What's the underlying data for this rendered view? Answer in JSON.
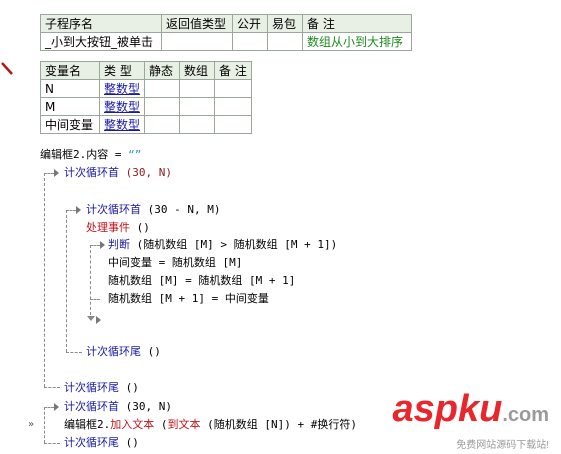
{
  "sub_table": {
    "headers": [
      "子程序名",
      "返回值类型",
      "公开",
      "易包",
      "备 注"
    ],
    "row": [
      "_小到大按钮_被单击",
      "",
      "",
      "",
      "数组从小到大排序"
    ]
  },
  "var_table": {
    "headers": [
      "变量名",
      "类 型",
      "静态",
      "数组",
      "备 注"
    ],
    "rows": [
      [
        "N",
        "整数型",
        "",
        "",
        ""
      ],
      [
        "M",
        "整数型",
        "",
        "",
        ""
      ],
      [
        "中间变量",
        "整数型",
        "",
        "",
        ""
      ]
    ]
  },
  "code": {
    "l1_a": "编辑框2.内容 = ",
    "l1_b": "“”",
    "l2_kw": "计次循环首",
    "l2_args": " (30, N)",
    "l3_kw": "计次循环首",
    "l3_args": " (30 - N, M)",
    "l4_kw": "处理事件",
    "l4_args": " ()",
    "l5_kw": "判断",
    "l5_args": " (随机数组 [M] > 随机数组 [M + 1])",
    "l6": "中间变量 = 随机数组 [M]",
    "l7": "随机数组 [M] = 随机数组 [M + 1]",
    "l8": "随机数组 [M + 1] = 中间变量",
    "l9_kw": "计次循环尾",
    "l9_args": " ()",
    "l10_kw": "计次循环尾",
    "l10_args": " ()",
    "l11_kw": "计次循环首",
    "l11_args": " (30, N)",
    "l12_a": "编辑框2.",
    "l12_b": "加入文本",
    "l12_c": " (",
    "l12_d": "到文本",
    "l12_e": " (随机数组 [N]) + #换行符)",
    "l13_kw": "计次循环尾",
    "l13_args": " ()"
  },
  "watermark": {
    "brand": "aspku",
    "suffix": ".com",
    "tagline": "免费网站源码下载站!"
  }
}
